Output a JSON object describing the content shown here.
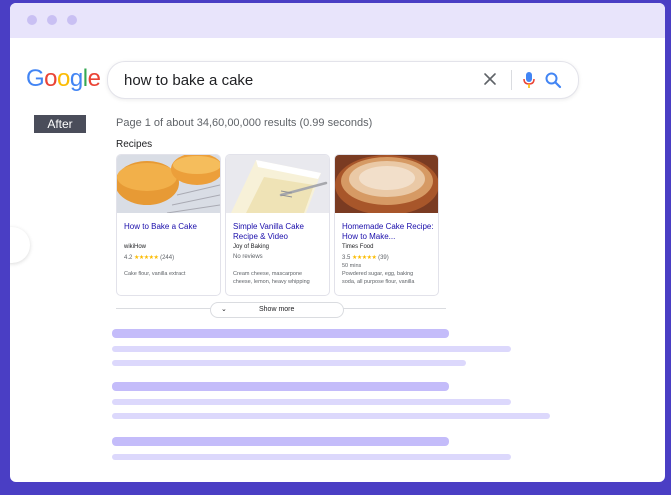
{
  "logo": {
    "text": "Google",
    "letters": [
      "G",
      "o",
      "o",
      "g",
      "l",
      "e"
    ],
    "colors": [
      "#4285f4",
      "#ea4335",
      "#fbbc05",
      "#4285f4",
      "#34a853",
      "#ea4335"
    ]
  },
  "search": {
    "query": "how to bake a cake"
  },
  "badge": {
    "label": "After"
  },
  "results": {
    "info": "Page 1 of about 34,60,00,000 results (0.99 seconds)"
  },
  "recipes": {
    "heading": "Recipes",
    "cards": [
      {
        "title": "How to Bake a Cake",
        "source": "wikiHow",
        "rating": "4.2",
        "stars": "★★★★★",
        "reviews": "(244)",
        "lines": [
          "Cake flour, vanilla extract"
        ]
      },
      {
        "title": "Simple Vanilla Cake Recipe & Video",
        "source": "Joy of Baking",
        "rating_text": "No reviews",
        "lines": [
          "Cream cheese, mascarpone",
          "cheese, lemon, heavy whipping"
        ]
      },
      {
        "title": "Homemade Cake Recipe: How to Make...",
        "source": "Times Food",
        "rating": "3.5",
        "stars": "★★★★★",
        "reviews": "(39)",
        "time": "50 mins",
        "lines": [
          "Powdered sugar, egg, baking",
          "soda, all purpose flour, vanilla"
        ]
      }
    ],
    "show_more": "Show more"
  },
  "colors": {
    "accent": "#4a3ec4",
    "link": "#1a0dab",
    "star": "#fbbc04"
  }
}
